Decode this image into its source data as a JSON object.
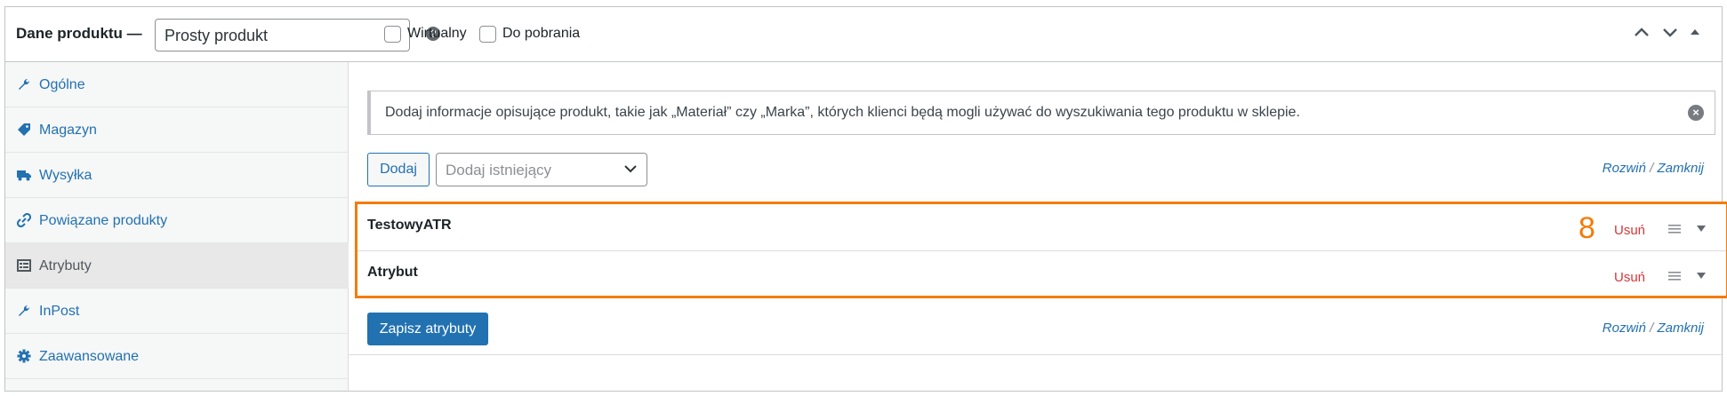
{
  "header": {
    "title": "Dane produktu —",
    "product_type": "Prosty produkt",
    "help_icon": "question-icon",
    "virtual_label": "Wirtualny",
    "downloadable_label": "Do pobrania"
  },
  "sidebar": {
    "items": [
      {
        "label": "Ogólne",
        "icon": "wrench-icon"
      },
      {
        "label": "Magazyn",
        "icon": "tag-icon"
      },
      {
        "label": "Wysyłka",
        "icon": "truck-icon"
      },
      {
        "label": "Powiązane produkty",
        "icon": "link-icon"
      },
      {
        "label": "Atrybuty",
        "icon": "list-icon",
        "active": true
      },
      {
        "label": "InPost",
        "icon": "wrench-icon"
      },
      {
        "label": "Zaawansowane",
        "icon": "gear-icon"
      }
    ]
  },
  "notice": {
    "text": "Dodaj informacje opisujące produkt, takie jak „Materiał” czy „Marka”, których klienci będą mogli używać do wyszukiwania tego produktu w sklepie.",
    "close": "×"
  },
  "toolbar": {
    "add_label": "Dodaj",
    "existing_placeholder": "Dodaj istniejący",
    "expand_label": "Rozwiń",
    "separator": " / ",
    "close_label": "Zamknij"
  },
  "attributes": {
    "annotation": "8",
    "rows": [
      {
        "name": "TestowyATR",
        "remove": "Usuń"
      },
      {
        "name": "Atrybut",
        "remove": "Usuń"
      }
    ]
  },
  "footer": {
    "save_label": "Zapisz atrybuty"
  },
  "colors": {
    "accent": "#2271b1",
    "highlight": "#f47b07",
    "danger": "#d63638"
  }
}
